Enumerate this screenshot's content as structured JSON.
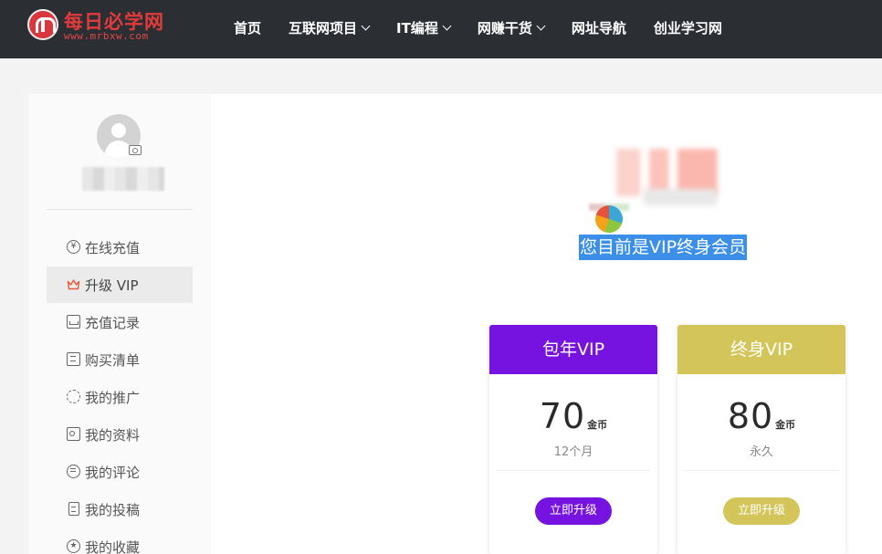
{
  "header": {
    "logo_title": "每日必学网",
    "logo_url": "www.mrbxw.com",
    "nav": [
      {
        "label": "首页",
        "has_dropdown": false
      },
      {
        "label": "互联网项目",
        "has_dropdown": true
      },
      {
        "label": "IT编程",
        "has_dropdown": true
      },
      {
        "label": "网赚干货",
        "has_dropdown": true
      },
      {
        "label": "网址导航",
        "has_dropdown": false
      },
      {
        "label": "创业学习网",
        "has_dropdown": false
      }
    ]
  },
  "sidebar": {
    "menu": [
      {
        "label": "在线充值",
        "icon": "yen-icon",
        "active": false
      },
      {
        "label": "升级 VIP",
        "icon": "crown-icon",
        "active": true
      },
      {
        "label": "充值记录",
        "icon": "inbox-icon",
        "active": false
      },
      {
        "label": "购买清单",
        "icon": "list-icon",
        "active": false
      },
      {
        "label": "我的推广",
        "icon": "spinner-icon",
        "active": false
      },
      {
        "label": "我的资料",
        "icon": "id-card-icon",
        "active": false
      },
      {
        "label": "我的评论",
        "icon": "comment-icon",
        "active": false
      },
      {
        "label": "我的投稿",
        "icon": "document-icon",
        "active": false
      },
      {
        "label": "我的收藏",
        "icon": "star-icon",
        "active": false
      }
    ]
  },
  "vip_status": {
    "text": "您目前是VIP终身会员"
  },
  "plans": [
    {
      "title": "包年VIP",
      "price": "70",
      "unit": "金币",
      "period": "12个月",
      "button": "立即升级",
      "color": "#7613e0"
    },
    {
      "title": "终身VIP",
      "price": "80",
      "unit": "金币",
      "period": "永久",
      "button": "立即升级",
      "color": "#d3c55a"
    }
  ],
  "colors": {
    "header_bg": "#2b2e33",
    "accent_red": "#e23b3b",
    "highlight_blue": "#3b8fe8"
  }
}
